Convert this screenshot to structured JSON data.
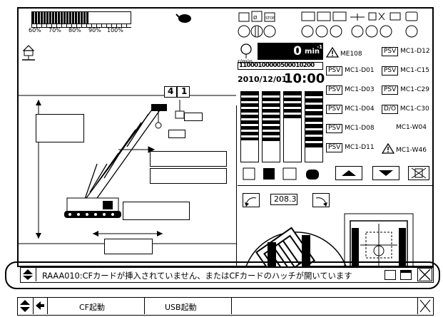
{
  "load_scale": {
    "labels": [
      "60%",
      "70%",
      "80%",
      "90%",
      "100%"
    ],
    "value_percent": 58
  },
  "speed": {
    "value": "0",
    "unit": "min",
    "exponent": "-1",
    "unit_left": "r/min"
  },
  "counter": "11000100000500010200",
  "datetime": {
    "date": "2010/12/01",
    "time": "10:00"
  },
  "boom_labels": {
    "top_right": "1",
    "top_left": "4"
  },
  "swing_angle": "208.3",
  "warnings": [
    {
      "tag": "",
      "code": "ME108",
      "warn": true
    },
    {
      "tag": "PSV",
      "code": "MC1-D12"
    },
    {
      "tag": "PSV",
      "code": "MC1-D01"
    },
    {
      "tag": "PSV",
      "code": "MC1-C15"
    },
    {
      "tag": "PSV",
      "code": "MC1-D03"
    },
    {
      "tag": "PSV",
      "code": "MC1-C29"
    },
    {
      "tag": "PSV",
      "code": "MC1-D04"
    },
    {
      "tag": "D/O",
      "code": "MC1-C30"
    },
    {
      "tag": "PSV",
      "code": "MC1-D08"
    },
    {
      "tag": "",
      "code": "MC1-W04"
    },
    {
      "tag": "PSV",
      "code": "MC1-D11"
    },
    {
      "tag": "",
      "code": "MC1-W46",
      "warn": true
    }
  ],
  "message_bar": {
    "text": "RAAA010:CFカードが挿入されていません、またはCFカードのハッチが開いています"
  },
  "bottom": {
    "cf_button": "CF起動",
    "usb_button": "USB起動"
  }
}
